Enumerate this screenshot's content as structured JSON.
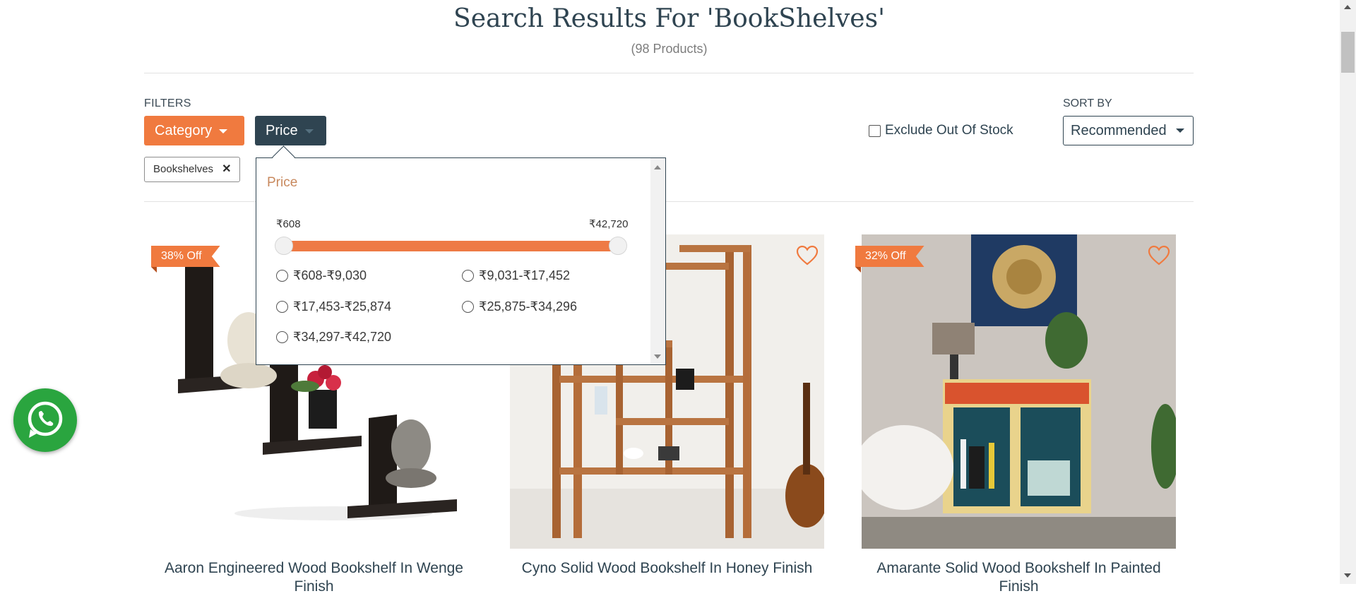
{
  "header": {
    "title": "Search Results For 'BookShelves'",
    "count": "(98 Products)"
  },
  "filters": {
    "label": "FILTERS",
    "category_label": "Category",
    "price_label": "Price",
    "chip": {
      "label": "Bookshelves"
    },
    "exclude_label": "Exclude Out Of Stock",
    "exclude_checked": false
  },
  "sort": {
    "label": "SORT BY",
    "value": "Recommended"
  },
  "price_dropdown": {
    "title": "Price",
    "min_label": "₹608",
    "max_label": "₹42,720",
    "options": [
      "₹608-₹9,030",
      "₹9,031-₹17,452",
      "₹17,453-₹25,874",
      "₹25,875-₹34,296",
      "₹34,297-₹42,720"
    ]
  },
  "products": [
    {
      "badge": "38% Off",
      "name": "Aaron Engineered Wood Bookshelf In Wenge Finish"
    },
    {
      "badge": "",
      "name": "Cyno Solid Wood Bookshelf In Honey Finish"
    },
    {
      "badge": "32% Off",
      "name": "Amarante Solid Wood Bookshelf In Painted Finish"
    }
  ],
  "colors": {
    "accent": "#f07a3f",
    "navy": "#2f4451",
    "whatsapp": "#2aa53f"
  }
}
